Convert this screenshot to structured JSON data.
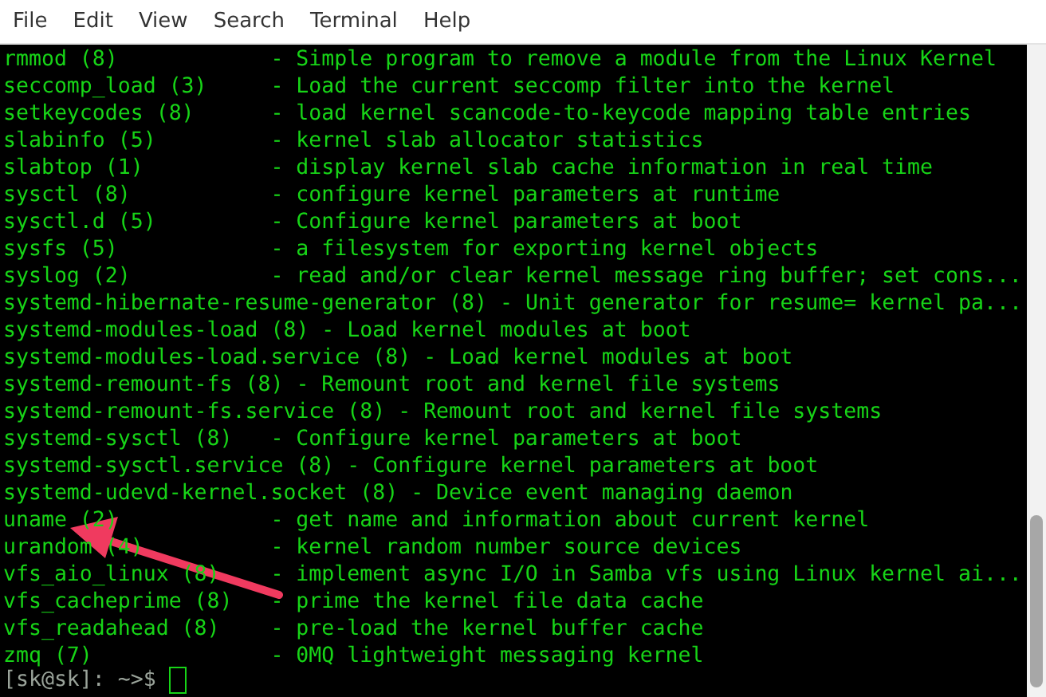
{
  "menu": [
    "File",
    "Edit",
    "View",
    "Search",
    "Terminal",
    "Help"
  ],
  "lines": [
    {
      "name": "rmmod (8)",
      "description": "- Simple program to remove a module from the Linux Kernel"
    },
    {
      "name": "seccomp_load (3)",
      "description": "- Load the current seccomp filter into the kernel"
    },
    {
      "name": "setkeycodes (8)",
      "description": "- load kernel scancode-to-keycode mapping table entries"
    },
    {
      "name": "slabinfo (5)",
      "description": "- kernel slab allocator statistics"
    },
    {
      "name": "slabtop (1)",
      "description": "- display kernel slab cache information in real time"
    },
    {
      "name": "sysctl (8)",
      "description": "- configure kernel parameters at runtime"
    },
    {
      "name": "sysctl.d (5)",
      "description": "- Configure kernel parameters at boot"
    },
    {
      "name": "sysfs (5)",
      "description": "- a filesystem for exporting kernel objects"
    },
    {
      "name": "syslog (2)",
      "description": "- read and/or clear kernel message ring buffer; set cons..."
    },
    {
      "name": "systemd-hibernate-resume-generator (8)",
      "description": "- Unit generator for resume= kernel pa..."
    },
    {
      "name": "systemd-modules-load (8)",
      "description": "- Load kernel modules at boot"
    },
    {
      "name": "systemd-modules-load.service (8)",
      "description": "- Load kernel modules at boot"
    },
    {
      "name": "systemd-remount-fs (8)",
      "description": "- Remount root and kernel file systems"
    },
    {
      "name": "systemd-remount-fs.service (8)",
      "description": "- Remount root and kernel file systems"
    },
    {
      "name": "systemd-sysctl (8)",
      "description": "- Configure kernel parameters at boot"
    },
    {
      "name": "systemd-sysctl.service (8)",
      "description": "- Configure kernel parameters at boot"
    },
    {
      "name": "systemd-udevd-kernel.socket (8)",
      "description": "- Device event managing daemon"
    },
    {
      "name": "uname (2)",
      "description": "- get name and information about current kernel"
    },
    {
      "name": "urandom (4)",
      "description": "- kernel random number source devices"
    },
    {
      "name": "vfs_aio_linux (8)",
      "description": "- implement async I/O in Samba vfs using Linux kernel ai..."
    },
    {
      "name": "vfs_cacheprime (8)",
      "description": "- prime the kernel file data cache"
    },
    {
      "name": "vfs_readahead (8)",
      "description": "- pre-load the kernel buffer cache"
    },
    {
      "name": "zmq (7)",
      "description": "- 0MQ lightweight messaging kernel"
    }
  ],
  "prompt": "[sk@sk]: ~>$"
}
